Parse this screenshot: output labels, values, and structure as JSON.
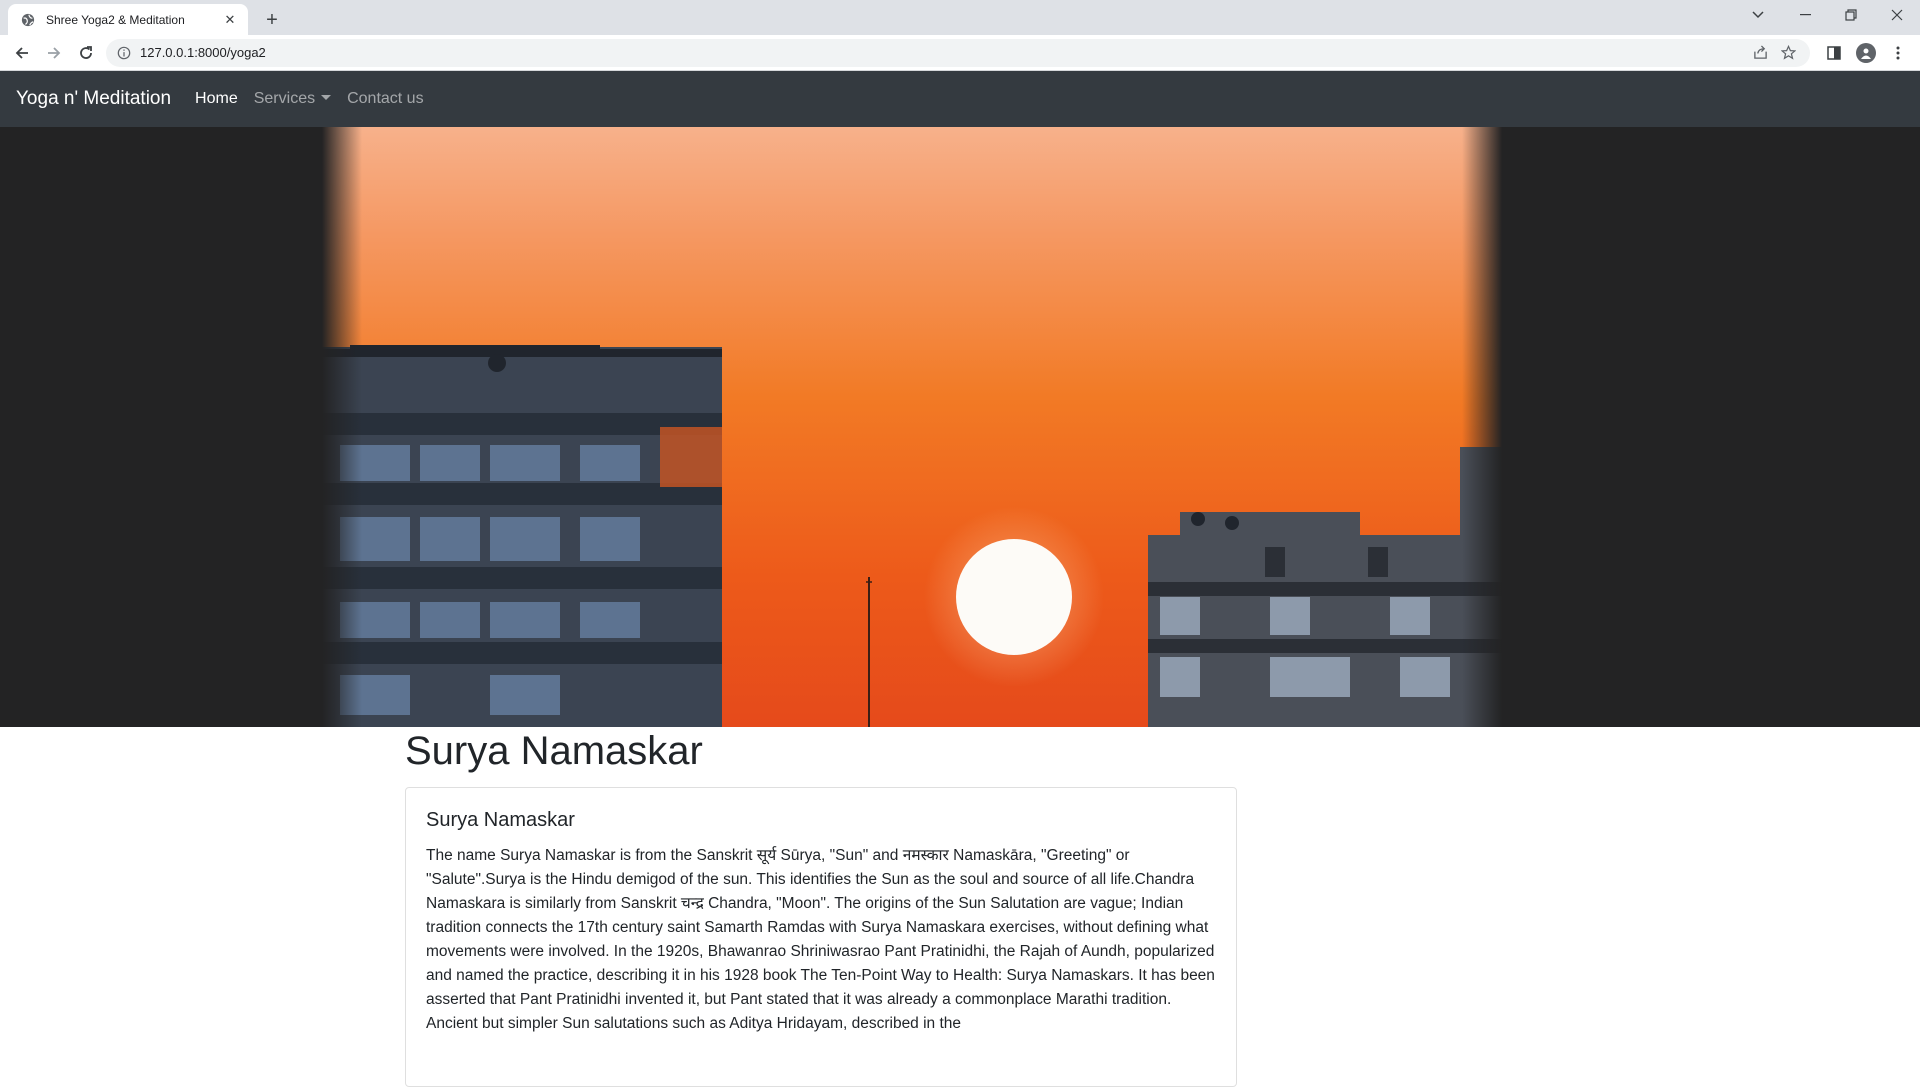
{
  "browser": {
    "tab_title": "Shree Yoga2 & Meditation",
    "tab_close": "✕",
    "new_tab": "+",
    "url": "127.0.0.1:8000/yoga2"
  },
  "navbar": {
    "brand": "Yoga n' Meditation",
    "links": [
      {
        "label": "Home"
      },
      {
        "label": "Services"
      },
      {
        "label": "Contact us"
      }
    ]
  },
  "content": {
    "page_title": "Surya Namaskar",
    "card_title": "Surya Namaskar",
    "card_text": "The name Surya Namaskar is from the Sanskrit सूर्य Sūrya, \"Sun\" and नमस्कार Namaskāra, \"Greeting\" or \"Salute\".Surya is the Hindu demigod of the sun. This identifies the Sun as the soul and source of all life.Chandra Namaskara is similarly from Sanskrit चन्द्र Chandra, \"Moon\". The origins of the Sun Salutation are vague; Indian tradition connects the 17th century saint Samarth Ramdas with Surya Namaskara exercises, without defining what movements were involved. In the 1920s, Bhawanrao Shriniwasrao Pant Pratinidhi, the Rajah of Aundh, popularized and named the practice, describing it in his 1928 book The Ten-Point Way to Health: Surya Namaskars. It has been asserted that Pant Pratinidhi invented it, but Pant stated that it was already a commonplace Marathi tradition. Ancient but simpler Sun salutations such as Aditya Hridayam, described in the"
  }
}
